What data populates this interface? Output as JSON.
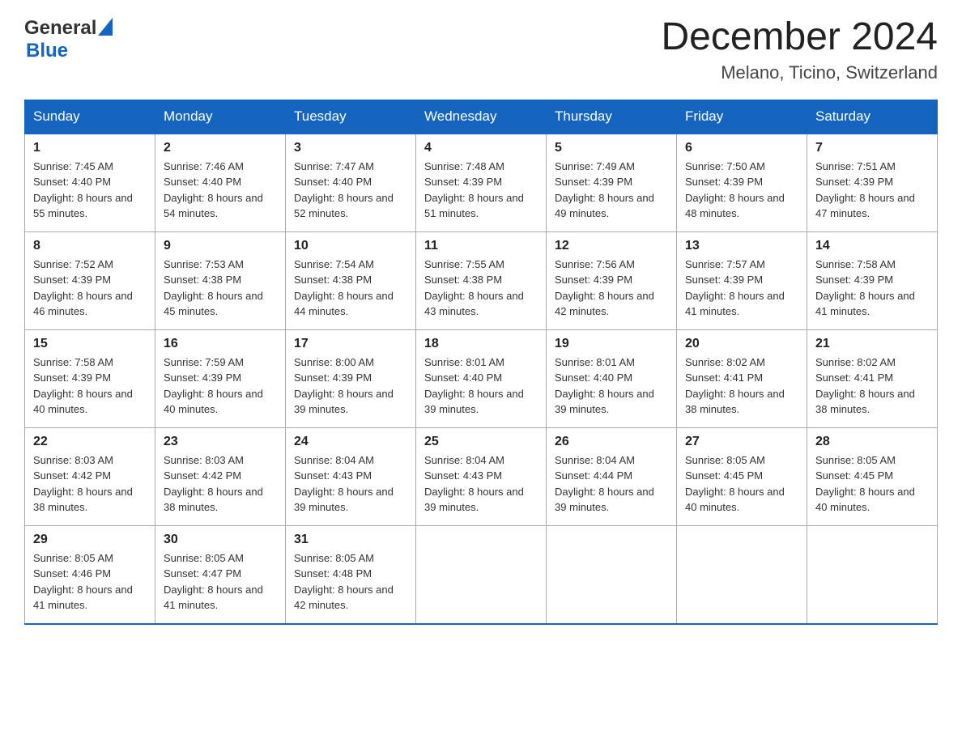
{
  "logo": {
    "general": "General",
    "blue": "Blue"
  },
  "title": {
    "month": "December 2024",
    "location": "Melano, Ticino, Switzerland"
  },
  "weekdays": [
    "Sunday",
    "Monday",
    "Tuesday",
    "Wednesday",
    "Thursday",
    "Friday",
    "Saturday"
  ],
  "weeks": [
    [
      {
        "day": "1",
        "sunrise": "7:45 AM",
        "sunset": "4:40 PM",
        "daylight": "8 hours and 55 minutes."
      },
      {
        "day": "2",
        "sunrise": "7:46 AM",
        "sunset": "4:40 PM",
        "daylight": "8 hours and 54 minutes."
      },
      {
        "day": "3",
        "sunrise": "7:47 AM",
        "sunset": "4:40 PM",
        "daylight": "8 hours and 52 minutes."
      },
      {
        "day": "4",
        "sunrise": "7:48 AM",
        "sunset": "4:39 PM",
        "daylight": "8 hours and 51 minutes."
      },
      {
        "day": "5",
        "sunrise": "7:49 AM",
        "sunset": "4:39 PM",
        "daylight": "8 hours and 49 minutes."
      },
      {
        "day": "6",
        "sunrise": "7:50 AM",
        "sunset": "4:39 PM",
        "daylight": "8 hours and 48 minutes."
      },
      {
        "day": "7",
        "sunrise": "7:51 AM",
        "sunset": "4:39 PM",
        "daylight": "8 hours and 47 minutes."
      }
    ],
    [
      {
        "day": "8",
        "sunrise": "7:52 AM",
        "sunset": "4:39 PM",
        "daylight": "8 hours and 46 minutes."
      },
      {
        "day": "9",
        "sunrise": "7:53 AM",
        "sunset": "4:38 PM",
        "daylight": "8 hours and 45 minutes."
      },
      {
        "day": "10",
        "sunrise": "7:54 AM",
        "sunset": "4:38 PM",
        "daylight": "8 hours and 44 minutes."
      },
      {
        "day": "11",
        "sunrise": "7:55 AM",
        "sunset": "4:38 PM",
        "daylight": "8 hours and 43 minutes."
      },
      {
        "day": "12",
        "sunrise": "7:56 AM",
        "sunset": "4:39 PM",
        "daylight": "8 hours and 42 minutes."
      },
      {
        "day": "13",
        "sunrise": "7:57 AM",
        "sunset": "4:39 PM",
        "daylight": "8 hours and 41 minutes."
      },
      {
        "day": "14",
        "sunrise": "7:58 AM",
        "sunset": "4:39 PM",
        "daylight": "8 hours and 41 minutes."
      }
    ],
    [
      {
        "day": "15",
        "sunrise": "7:58 AM",
        "sunset": "4:39 PM",
        "daylight": "8 hours and 40 minutes."
      },
      {
        "day": "16",
        "sunrise": "7:59 AM",
        "sunset": "4:39 PM",
        "daylight": "8 hours and 40 minutes."
      },
      {
        "day": "17",
        "sunrise": "8:00 AM",
        "sunset": "4:39 PM",
        "daylight": "8 hours and 39 minutes."
      },
      {
        "day": "18",
        "sunrise": "8:01 AM",
        "sunset": "4:40 PM",
        "daylight": "8 hours and 39 minutes."
      },
      {
        "day": "19",
        "sunrise": "8:01 AM",
        "sunset": "4:40 PM",
        "daylight": "8 hours and 39 minutes."
      },
      {
        "day": "20",
        "sunrise": "8:02 AM",
        "sunset": "4:41 PM",
        "daylight": "8 hours and 38 minutes."
      },
      {
        "day": "21",
        "sunrise": "8:02 AM",
        "sunset": "4:41 PM",
        "daylight": "8 hours and 38 minutes."
      }
    ],
    [
      {
        "day": "22",
        "sunrise": "8:03 AM",
        "sunset": "4:42 PM",
        "daylight": "8 hours and 38 minutes."
      },
      {
        "day": "23",
        "sunrise": "8:03 AM",
        "sunset": "4:42 PM",
        "daylight": "8 hours and 38 minutes."
      },
      {
        "day": "24",
        "sunrise": "8:04 AM",
        "sunset": "4:43 PM",
        "daylight": "8 hours and 39 minutes."
      },
      {
        "day": "25",
        "sunrise": "8:04 AM",
        "sunset": "4:43 PM",
        "daylight": "8 hours and 39 minutes."
      },
      {
        "day": "26",
        "sunrise": "8:04 AM",
        "sunset": "4:44 PM",
        "daylight": "8 hours and 39 minutes."
      },
      {
        "day": "27",
        "sunrise": "8:05 AM",
        "sunset": "4:45 PM",
        "daylight": "8 hours and 40 minutes."
      },
      {
        "day": "28",
        "sunrise": "8:05 AM",
        "sunset": "4:45 PM",
        "daylight": "8 hours and 40 minutes."
      }
    ],
    [
      {
        "day": "29",
        "sunrise": "8:05 AM",
        "sunset": "4:46 PM",
        "daylight": "8 hours and 41 minutes."
      },
      {
        "day": "30",
        "sunrise": "8:05 AM",
        "sunset": "4:47 PM",
        "daylight": "8 hours and 41 minutes."
      },
      {
        "day": "31",
        "sunrise": "8:05 AM",
        "sunset": "4:48 PM",
        "daylight": "8 hours and 42 minutes."
      },
      null,
      null,
      null,
      null
    ]
  ]
}
